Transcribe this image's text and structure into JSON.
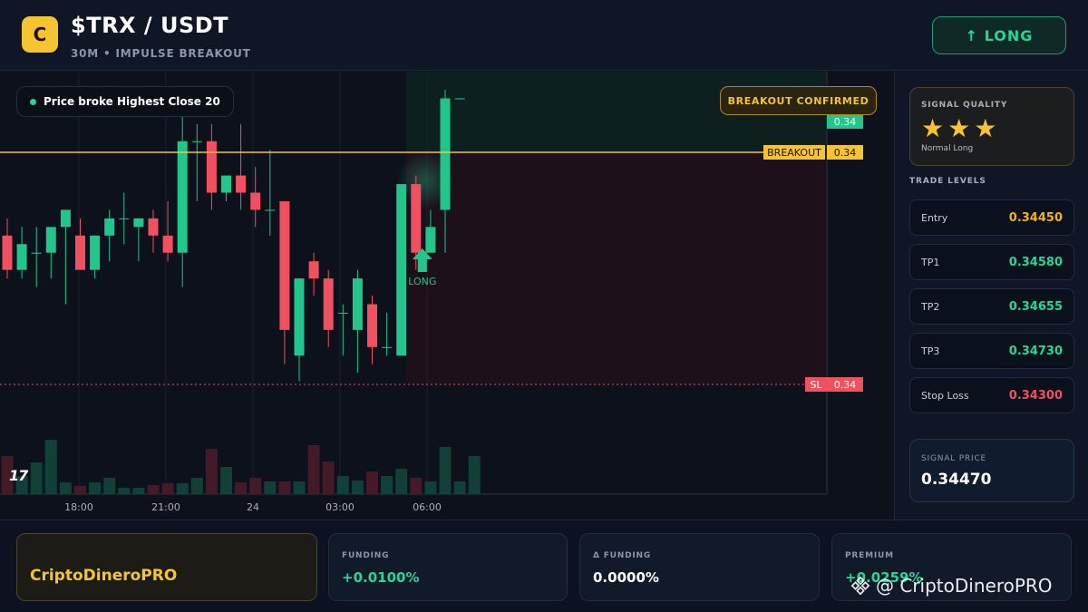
{
  "header": {
    "logo_letter": "C",
    "title": "$TRX / USDT",
    "subtitle": "30M • IMPULSE BREAKOUT",
    "long_button": "↑ LONG"
  },
  "chart": {
    "pill_text": "Price broke Highest Close 20",
    "confirmed_label": "BREAKOUT CONFIRMED",
    "breakout_label": "BREAKOUT",
    "breakout_value": "0.34",
    "top_value": "0.34",
    "sl_label": "SL",
    "sl_value": "0.34",
    "signal_marker_label": "LONG",
    "x_ticks": [
      "18:00",
      "21:00",
      "24",
      "03:00",
      "06:00"
    ],
    "tv_logo": "17",
    "colors": {
      "up": "#22c58a",
      "down": "#f0505f",
      "breakout": "#f6c431",
      "sl": "#f0505f"
    }
  },
  "chart_data": {
    "type": "candlestick",
    "x_tick_labels": [
      "18:00",
      "21:00",
      "24",
      "03:00",
      "06:00"
    ],
    "y_range": [
      0.3425,
      0.3462
    ],
    "candles": [
      {
        "o": 0.3445,
        "h": 0.3447,
        "l": 0.344,
        "c": 0.3441
      },
      {
        "o": 0.3441,
        "h": 0.3446,
        "l": 0.344,
        "c": 0.3444
      },
      {
        "o": 0.3443,
        "h": 0.3446,
        "l": 0.3439,
        "c": 0.3443
      },
      {
        "o": 0.3443,
        "h": 0.3446,
        "l": 0.344,
        "c": 0.3446
      },
      {
        "o": 0.3446,
        "h": 0.3448,
        "l": 0.3437,
        "c": 0.3448
      },
      {
        "o": 0.3445,
        "h": 0.3447,
        "l": 0.3441,
        "c": 0.3441
      },
      {
        "o": 0.3441,
        "h": 0.3445,
        "l": 0.344,
        "c": 0.3445
      },
      {
        "o": 0.3445,
        "h": 0.3448,
        "l": 0.3442,
        "c": 0.3447
      },
      {
        "o": 0.3447,
        "h": 0.345,
        "l": 0.3444,
        "c": 0.3447
      },
      {
        "o": 0.3446,
        "h": 0.3447,
        "l": 0.3442,
        "c": 0.3447
      },
      {
        "o": 0.3447,
        "h": 0.3448,
        "l": 0.3443,
        "c": 0.3445
      },
      {
        "o": 0.3445,
        "h": 0.3449,
        "l": 0.3442,
        "c": 0.3443
      },
      {
        "o": 0.3443,
        "h": 0.346,
        "l": 0.3439,
        "c": 0.3456
      },
      {
        "o": 0.3456,
        "h": 0.3458,
        "l": 0.3449,
        "c": 0.3456
      },
      {
        "o": 0.3456,
        "h": 0.3458,
        "l": 0.3448,
        "c": 0.345
      },
      {
        "o": 0.345,
        "h": 0.3452,
        "l": 0.3449,
        "c": 0.3452
      },
      {
        "o": 0.3452,
        "h": 0.3458,
        "l": 0.3448,
        "c": 0.345
      },
      {
        "o": 0.345,
        "h": 0.3453,
        "l": 0.3446,
        "c": 0.3448
      },
      {
        "o": 0.3448,
        "h": 0.3455,
        "l": 0.3445,
        "c": 0.3448
      },
      {
        "o": 0.3449,
        "h": 0.3448,
        "l": 0.343,
        "c": 0.3434
      },
      {
        "o": 0.3431,
        "h": 0.344,
        "l": 0.3428,
        "c": 0.344
      },
      {
        "o": 0.3442,
        "h": 0.3443,
        "l": 0.3438,
        "c": 0.344
      },
      {
        "o": 0.344,
        "h": 0.3441,
        "l": 0.3432,
        "c": 0.3434
      },
      {
        "o": 0.3436,
        "h": 0.3437,
        "l": 0.3431,
        "c": 0.3436
      },
      {
        "o": 0.3434,
        "h": 0.3441,
        "l": 0.3429,
        "c": 0.344
      },
      {
        "o": 0.3437,
        "h": 0.3438,
        "l": 0.343,
        "c": 0.3432
      },
      {
        "o": 0.3432,
        "h": 0.3436,
        "l": 0.3431,
        "c": 0.3432
      },
      {
        "o": 0.3431,
        "h": 0.3451,
        "l": 0.3431,
        "c": 0.3451
      },
      {
        "o": 0.3451,
        "h": 0.3452,
        "l": 0.3441,
        "c": 0.3443
      },
      {
        "o": 0.3443,
        "h": 0.3448,
        "l": 0.3443,
        "c": 0.3446
      },
      {
        "o": 0.3448,
        "h": 0.3462,
        "l": 0.3443,
        "c": 0.3461
      },
      {
        "o": 0.3461,
        "h": 0.3461,
        "l": 0.3461,
        "c": 0.3461
      }
    ],
    "volumes": [
      42,
      20,
      35,
      60,
      13,
      9,
      13,
      18,
      7,
      7,
      10,
      12,
      12,
      18,
      50,
      30,
      13,
      18,
      14,
      14,
      14,
      54,
      36,
      20,
      15,
      25,
      20,
      28,
      18,
      14,
      52,
      14,
      42
    ]
  },
  "sidebar": {
    "signal_quality_label": "SIGNAL QUALITY",
    "stars": "★★★",
    "quality_note": "Normal Long",
    "trade_levels_title": "TRADE LEVELS",
    "levels": [
      {
        "name": "Entry",
        "value": "0.34450",
        "color": "#f6b01e"
      },
      {
        "name": "TP1",
        "value": "0.34580",
        "color": "#27d696"
      },
      {
        "name": "TP2",
        "value": "0.34655",
        "color": "#27d696"
      },
      {
        "name": "TP3",
        "value": "0.34730",
        "color": "#27d696"
      },
      {
        "name": "Stop Loss",
        "value": "0.34300",
        "color": "#f0505f"
      }
    ],
    "signal_price_label": "SIGNAL PRICE",
    "signal_price_value": "0.34470"
  },
  "footer": {
    "brand": "CriptoDineroPRO",
    "stats": [
      {
        "label": "FUNDING",
        "value": "+0.0100%",
        "color": "#27d696"
      },
      {
        "label": "Δ FUNDING",
        "value": "0.0000%",
        "color": "#ffffff"
      },
      {
        "label": "PREMIUM",
        "value": "+0.0259%",
        "color": "#27d696"
      }
    ],
    "watermark": "@ CriptoDineroPRO"
  }
}
